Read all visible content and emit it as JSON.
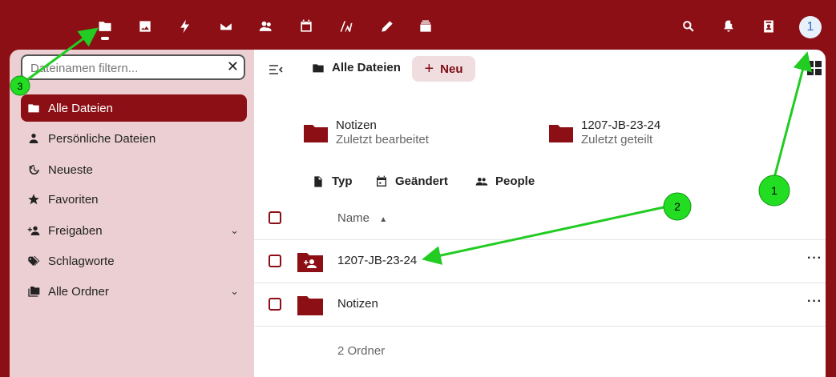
{
  "topbar": {
    "apps": [
      {
        "icon": "folder-icon"
      },
      {
        "icon": "photos-icon"
      },
      {
        "icon": "activity-icon"
      },
      {
        "icon": "mail-icon"
      },
      {
        "icon": "contacts-icon"
      },
      {
        "icon": "calendar-icon"
      },
      {
        "icon": "notes-icon"
      },
      {
        "icon": "edit-icon"
      },
      {
        "icon": "deck-icon"
      }
    ],
    "avatar_initial": "1"
  },
  "sidebar": {
    "filter_placeholder": "Dateinamen filtern...",
    "items": [
      {
        "label": "Alle Dateien",
        "icon": "folder-icon",
        "active": true
      },
      {
        "label": "Persönliche Dateien",
        "icon": "person-icon"
      },
      {
        "label": "Neueste",
        "icon": "history-icon"
      },
      {
        "label": "Favoriten",
        "icon": "star-icon"
      },
      {
        "label": "Freigaben",
        "icon": "share-icon",
        "expandable": true
      },
      {
        "label": "Schlagworte",
        "icon": "tag-icon"
      },
      {
        "label": "Alle Ordner",
        "icon": "folders-icon",
        "expandable": true
      }
    ]
  },
  "main": {
    "breadcrumb": "Alle Dateien",
    "new_button": "Neu",
    "recent": [
      {
        "name": "Notizen",
        "subtitle": "Zuletzt bearbeitet"
      },
      {
        "name": "1207-JB-23-24",
        "subtitle": "Zuletzt geteilt"
      }
    ],
    "filters": [
      {
        "label": "Typ",
        "icon": "file-icon"
      },
      {
        "label": "Geändert",
        "icon": "calendar-icon"
      },
      {
        "label": "People",
        "icon": "people-icon"
      }
    ],
    "column_name": "Name",
    "files": [
      {
        "name": "1207-JB-23-24",
        "shared": true
      },
      {
        "name": "Notizen",
        "shared": false
      }
    ],
    "summary": "2 Ordner"
  },
  "annotations": [
    {
      "label": "1"
    },
    {
      "label": "2"
    },
    {
      "label": "3"
    }
  ],
  "colors": {
    "brand": "#8b0f14",
    "sidebar": "#ebcfd2",
    "annotation": "#22cc22"
  }
}
